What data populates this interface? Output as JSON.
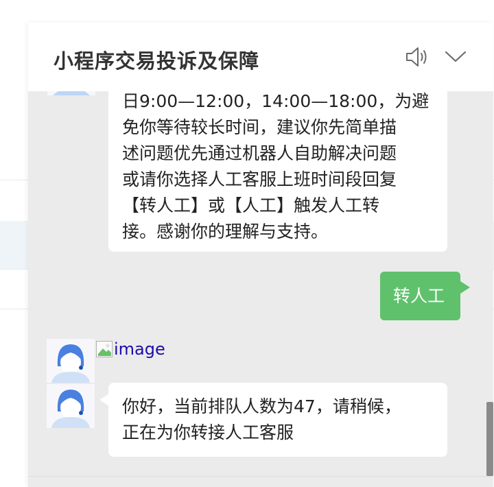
{
  "header": {
    "title": "小程序交易投诉及保障",
    "sound_icon": "speaker-icon",
    "collapse_icon": "chevron-down-icon"
  },
  "messages": [
    {
      "direction": "incoming",
      "lines": [
        "日9:00—12:00，14:00—18:00，为避",
        "免你等待较长时间，建议你先简单描",
        "述问题优先通过机器人自助解决问题",
        "或请你选择人工客服上班时间段回复",
        "【转人工】或【人工】触发人工转",
        "接。感谢你的理解与支持。"
      ]
    },
    {
      "direction": "outgoing",
      "text": "转人工"
    },
    {
      "direction": "incoming",
      "image_alt": "image"
    },
    {
      "direction": "incoming",
      "lines": [
        "你好，当前排队人数为47，请稍候，",
        "正在为你转接人工客服"
      ]
    }
  ],
  "colors": {
    "outgoing_bubble": "#5fc16c",
    "panel_background": "#ebebeb",
    "title_text": "#333333"
  }
}
